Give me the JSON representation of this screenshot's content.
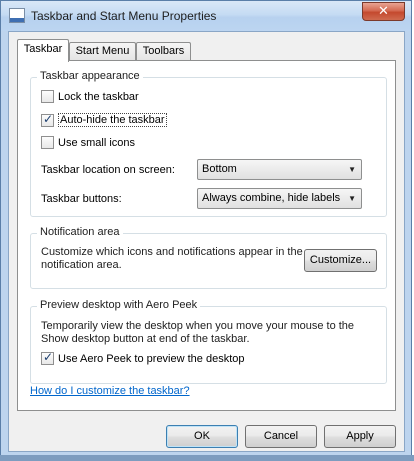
{
  "window": {
    "title": "Taskbar and Start Menu Properties",
    "close_glyph": "✕"
  },
  "tabs": [
    {
      "label": "Taskbar",
      "active": true
    },
    {
      "label": "Start Menu",
      "active": false
    },
    {
      "label": "Toolbars",
      "active": false
    }
  ],
  "appearance": {
    "title": "Taskbar appearance",
    "lock": {
      "label": "Lock the taskbar",
      "checked": false
    },
    "autohide": {
      "label": "Auto-hide the taskbar",
      "checked": true
    },
    "small_icons": {
      "label": "Use small icons",
      "checked": false
    },
    "location_label": "Taskbar location on screen:",
    "location_value": "Bottom",
    "buttons_label": "Taskbar buttons:",
    "buttons_value": "Always combine, hide labels"
  },
  "notification": {
    "title": "Notification area",
    "text_line1": "Customize which icons and notifications appear in the",
    "text_line2": "notification area.",
    "customize_label": "Customize..."
  },
  "peek": {
    "title": "Preview desktop with Aero Peek",
    "text_line1": "Temporarily view the desktop when you move your mouse to the",
    "text_line2": "Show desktop button at end of the taskbar.",
    "use_peek": {
      "label": "Use Aero Peek to preview the desktop",
      "checked": true
    }
  },
  "help_link": "How do I customize the taskbar?",
  "footer": {
    "ok": "OK",
    "cancel": "Cancel",
    "apply": "Apply"
  },
  "icons": {
    "dropdown_arrow": "▼"
  }
}
